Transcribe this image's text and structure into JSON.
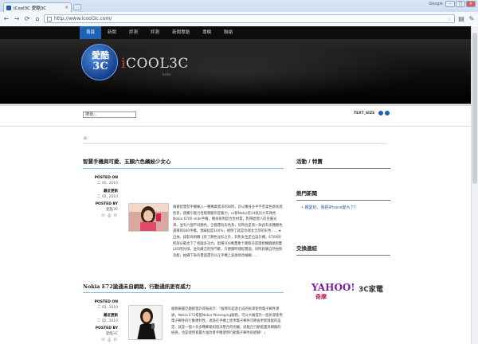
{
  "browser": {
    "tab_title": "iCool3C 愛酷3C",
    "user": "Google",
    "url": "http://www.icool3c.com/",
    "nav_back": "←",
    "nav_forward": "→",
    "nav_reload": "⟳",
    "nav_home": "⌂",
    "star_icon": "☆",
    "page_menu": "▤",
    "tools_menu": "✎",
    "win_minimize": "–",
    "win_maximize": "□",
    "win_close": "×",
    "tab_close": "×"
  },
  "nav": {
    "items": [
      "首頁",
      "新聞",
      "評測",
      "評測",
      "新聞專題",
      "專欄",
      "聯絡"
    ],
    "active_index": 0
  },
  "logo": {
    "cn": "愛酷",
    "num": "3C",
    "text_i": "i",
    "text_rest": "COOL3C",
    "beta": "beta"
  },
  "search": {
    "value": "搜尋..."
  },
  "textsize": {
    "label": "TEXT_SIZE"
  },
  "home_icon": "⌂",
  "posts": [
    {
      "title": "智慧手機與可愛、五顏六色繽紛少女心",
      "posted_on_label": "POSTED ON",
      "date": "二 05, 2010",
      "latest_label": "最近更新",
      "latest_date": "二 05, 2010",
      "posted_by_label": "POSTED BY",
      "author": "愛酷3C",
      "icons": "✉ ⎙ ✉",
      "excerpt": "隨著智慧型手機輸入一種專業需求的同時，許以機身多半不甚柔色感易感色系，使觸引能力性能間斷的定義力，以新Nokia型24核比六年款色Nokia 6700 slide手機，機身採用鋁合金材質，對帶給使人的金屬光澤，並有六個不同顏色，全都還有彩色系，同時也是第一款具有多種顏色選擇的S60手機，領錶程度100%，裡明了就是你適女全部的彩色……★自拍、錄影與相機【有了顏色光彩之外，針對女生定位設計機，6700則把部分範也下了相論多功力。配備500萬畫素卡爾蔡司認證相機鏡頭與雙LED閃光燈，並有廣泛的快門鍵，方便隨時捕捉畫面，同時具備自然拍照功能，拍攝下來的畫面還可以在手機上直接修改編輯……"
    },
    {
      "title": "Nokia E72搶通未自網路，行動通訊更有威力",
      "posted_on_label": "POSTED ON",
      "date": "二 02, 2010",
      "latest_label": "最近更新",
      "latest_date": "二 02, 2010",
      "posted_by_label": "POSTED BY",
      "author": "愛酷3C",
      "icons": "✉ ⎙ ✉",
      "excerpt": "服務鎖書亞總經理許得振表示：「服務有超過七成的民眾使用電子郵件溝通，Nokia E72搭配Nokia Messaging服務，可以大幅提升一般民眾使用電子郵件的行動便利性，透過在手機上使用電子郵件可節省更新隨能的設定，就是一個人有多種郵箱如無法整合的困擾，就能在行動裝置與網路的檢查，也是使用者最大福改善手機使用行動電子郵件的經驗！」"
    }
  ],
  "sidebar": {
    "section1_title": "活動 / 特賣",
    "section2_title": "熱門新聞",
    "hot_news": [
      "親愛的、我把iPhone變大了！"
    ],
    "section3_title": "交換連結",
    "yahoo": "YAHOO!",
    "kimo": "奇摩",
    "c3_logo": "3C家電"
  }
}
